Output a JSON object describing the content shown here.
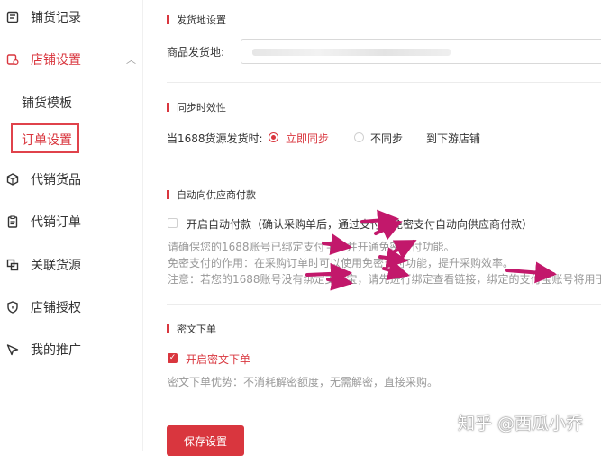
{
  "sidebar": {
    "items": [
      {
        "label": "铺货记录",
        "icon": "record-icon"
      },
      {
        "label": "店铺设置",
        "icon": "store-settings-icon"
      },
      {
        "label": "代销货品",
        "icon": "package-icon"
      },
      {
        "label": "代销订单",
        "icon": "order-icon"
      },
      {
        "label": "关联货源",
        "icon": "link-source-icon"
      },
      {
        "label": "店铺授权",
        "icon": "shield-icon"
      },
      {
        "label": "我的推广",
        "icon": "promotion-icon"
      }
    ],
    "sub_items": [
      {
        "label": "铺货模板"
      },
      {
        "label": "订单设置"
      }
    ]
  },
  "sections": {
    "shipping": {
      "title": "发货地设置",
      "field_label": "商品发货地:"
    },
    "sync": {
      "title": "同步时效性",
      "prefix": "当1688货源发货时:",
      "option_sync": "立即同步",
      "option_nosync": "不同步",
      "suffix": "到下游店铺"
    },
    "auto_pay": {
      "title": "自动向供应商付款",
      "checkbox_label": "开启自动付款（确认采购单后，通过支付宝免密支付自动向供应商付款）",
      "note1": "请确保您的1688账号已绑定支付宝，并开通免密支付功能。",
      "note2": "免密支付的作用：在采购订单时可以使用免密支付功能，提升采购效率。",
      "note3": "注意：若您的1688账号没有绑定支付宝，请先进行绑定查看链接，绑定的支付宝账号将用于"
    },
    "encrypted": {
      "title": "密文下单",
      "checkbox_label": "开启密文下单",
      "note": "密文下单优势：不消耗解密额度，无需解密，直接采购。"
    }
  },
  "save_button": "保存设置",
  "watermark": "知乎 @西瓜小乔",
  "colors": {
    "accent": "#d9363e",
    "arrow": "#c2186b"
  }
}
